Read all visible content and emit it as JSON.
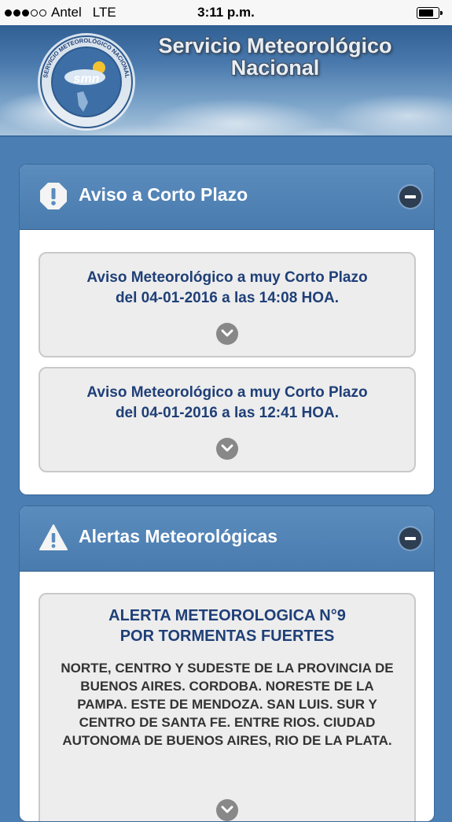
{
  "status_bar": {
    "carrier": "Antel",
    "network": "LTE",
    "time": "3:11 p.m.",
    "signal_bars": 3,
    "battery_level": 0.75
  },
  "header": {
    "title_line1": "Servicio Meteorológico",
    "title_line2": "Nacional",
    "logo_text": "SERVICIO METEOROLÓGICO NACIONAL",
    "logo_mark": "smn"
  },
  "short_term": {
    "title": "Aviso a Corto Plazo",
    "icon": "exclamation-octagon-icon",
    "items": [
      {
        "line1": "Aviso Meteorológico a muy Corto Plazo",
        "line2": "del 04-01-2016 a las 14:08 HOA."
      },
      {
        "line1": "Aviso Meteorológico a muy Corto Plazo",
        "line2": "del 04-01-2016 a las 12:41 HOA."
      }
    ]
  },
  "alerts": {
    "title": "Alertas Meteorológicas",
    "icon": "warning-triangle-icon",
    "items": [
      {
        "title_line1": "ALERTA METEOROLOGICA N°9",
        "title_line2": "POR TORMENTAS FUERTES",
        "body": "NORTE, CENTRO Y SUDESTE DE LA PROVINCIA DE BUENOS AIRES. CORDOBA. NORESTE DE LA PAMPA. ESTE DE MENDOZA. SAN LUIS. SUR Y CENTRO DE SANTA FE. ENTRE RIOS. CIUDAD AUTONOMA DE BUENOS AIRES, RIO DE LA PLATA."
      }
    ]
  },
  "colors": {
    "page_bg": "#4b7fb3",
    "panel_header": "#4a7bae",
    "card_text": "#1f3f77",
    "card_bg": "#ededed"
  }
}
